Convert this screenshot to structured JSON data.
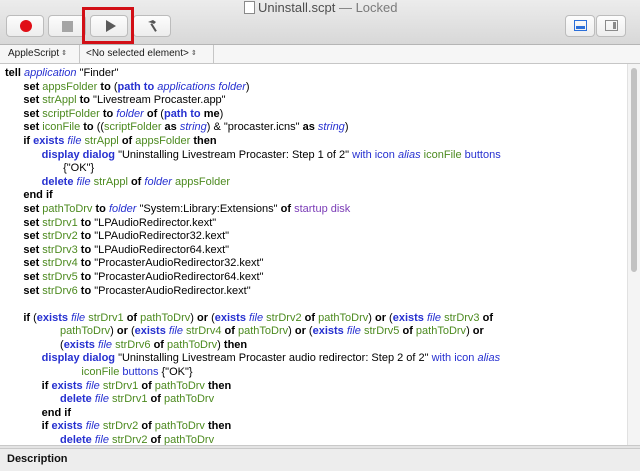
{
  "window": {
    "title": "Uninstall.scpt",
    "title_separator": "—",
    "status": "Locked"
  },
  "toolbar": {
    "record_icon": "record-icon",
    "stop_icon": "stop-icon",
    "run_icon": "play-icon",
    "compile_icon": "hammer-icon",
    "view_split_icon": "split-view-icon",
    "view_side_icon": "sidebar-view-icon",
    "accent": "#2b6fd9",
    "highlight_color": "#d20f16"
  },
  "navigation": {
    "language": "AppleScript",
    "element": "<No selected element>"
  },
  "script": {
    "lines": [
      [
        {
          "t": "tell ",
          "c": "kw"
        },
        {
          "t": "application",
          "c": "cls"
        },
        {
          "t": " \"Finder\"",
          "c": "str"
        }
      ],
      [
        {
          "t": "      set ",
          "c": "kw"
        },
        {
          "t": "appsFolder",
          "c": "var"
        },
        {
          "t": " to ",
          "c": "kw"
        },
        {
          "t": "(",
          "c": "str"
        },
        {
          "t": "path to",
          "c": "cmd"
        },
        {
          "t": " ",
          "c": "str"
        },
        {
          "t": "applications folder",
          "c": "cls"
        },
        {
          "t": ")",
          "c": "str"
        }
      ],
      [
        {
          "t": "      set ",
          "c": "kw"
        },
        {
          "t": "strAppl",
          "c": "var"
        },
        {
          "t": " to ",
          "c": "kw"
        },
        {
          "t": "\"Livestream Procaster.app\"",
          "c": "str"
        }
      ],
      [
        {
          "t": "      set ",
          "c": "kw"
        },
        {
          "t": "scriptFolder",
          "c": "var"
        },
        {
          "t": " to ",
          "c": "kw"
        },
        {
          "t": "folder",
          "c": "cls"
        },
        {
          "t": " of ",
          "c": "kw"
        },
        {
          "t": "(",
          "c": "str"
        },
        {
          "t": "path to",
          "c": "cmd"
        },
        {
          "t": " me",
          "c": "kw"
        },
        {
          "t": ")",
          "c": "str"
        }
      ],
      [
        {
          "t": "      set ",
          "c": "kw"
        },
        {
          "t": "iconFile",
          "c": "var"
        },
        {
          "t": " to ",
          "c": "kw"
        },
        {
          "t": "((",
          "c": "str"
        },
        {
          "t": "scriptFolder",
          "c": "var"
        },
        {
          "t": " as ",
          "c": "kw"
        },
        {
          "t": "string",
          "c": "cls"
        },
        {
          "t": ") & \"procaster.icns\" ",
          "c": "str"
        },
        {
          "t": "as ",
          "c": "kw"
        },
        {
          "t": "string",
          "c": "cls"
        },
        {
          "t": ")",
          "c": "str"
        }
      ],
      [
        {
          "t": "      if ",
          "c": "kw"
        },
        {
          "t": "exists",
          "c": "cmd"
        },
        {
          "t": " ",
          "c": "str"
        },
        {
          "t": "file",
          "c": "cls"
        },
        {
          "t": " ",
          "c": "str"
        },
        {
          "t": "strAppl",
          "c": "var"
        },
        {
          "t": " of ",
          "c": "kw"
        },
        {
          "t": "appsFolder",
          "c": "var"
        },
        {
          "t": " then",
          "c": "kw"
        }
      ],
      [
        {
          "t": "            display dialog",
          "c": "cmd"
        },
        {
          "t": " \"Uninstalling Livestream Procaster: Step 1 of 2\" ",
          "c": "str"
        },
        {
          "t": "with icon",
          "c": "par"
        },
        {
          "t": " ",
          "c": "str"
        },
        {
          "t": "alias",
          "c": "cls"
        },
        {
          "t": " ",
          "c": "str"
        },
        {
          "t": "iconFile",
          "c": "var"
        },
        {
          "t": " buttons",
          "c": "par"
        }
      ],
      [
        {
          "t": "                   {\"OK\"}",
          "c": "str"
        }
      ],
      [
        {
          "t": "            delete",
          "c": "cmd"
        },
        {
          "t": " ",
          "c": "str"
        },
        {
          "t": "file",
          "c": "cls"
        },
        {
          "t": " ",
          "c": "str"
        },
        {
          "t": "strAppl",
          "c": "var"
        },
        {
          "t": " of ",
          "c": "kw"
        },
        {
          "t": "folder",
          "c": "cls"
        },
        {
          "t": " ",
          "c": "str"
        },
        {
          "t": "appsFolder",
          "c": "var"
        }
      ],
      [
        {
          "t": "      end if",
          "c": "kw"
        }
      ],
      [
        {
          "t": "      set ",
          "c": "kw"
        },
        {
          "t": "pathToDrv",
          "c": "var"
        },
        {
          "t": " to ",
          "c": "kw"
        },
        {
          "t": "folder",
          "c": "cls"
        },
        {
          "t": " \"System:Library:Extensions\" ",
          "c": "str"
        },
        {
          "t": "of ",
          "c": "kw"
        },
        {
          "t": "startup disk",
          "c": "prop"
        }
      ],
      [
        {
          "t": "      set ",
          "c": "kw"
        },
        {
          "t": "strDrv1",
          "c": "var"
        },
        {
          "t": " to ",
          "c": "kw"
        },
        {
          "t": "\"LPAudioRedirector.kext\"",
          "c": "str"
        }
      ],
      [
        {
          "t": "      set ",
          "c": "kw"
        },
        {
          "t": "strDrv2",
          "c": "var"
        },
        {
          "t": " to ",
          "c": "kw"
        },
        {
          "t": "\"LPAudioRedirector32.kext\"",
          "c": "str"
        }
      ],
      [
        {
          "t": "      set ",
          "c": "kw"
        },
        {
          "t": "strDrv3",
          "c": "var"
        },
        {
          "t": " to ",
          "c": "kw"
        },
        {
          "t": "\"LPAudioRedirector64.kext\"",
          "c": "str"
        }
      ],
      [
        {
          "t": "      set ",
          "c": "kw"
        },
        {
          "t": "strDrv4",
          "c": "var"
        },
        {
          "t": " to ",
          "c": "kw"
        },
        {
          "t": "\"ProcasterAudioRedirector32.kext\"",
          "c": "str"
        }
      ],
      [
        {
          "t": "      set ",
          "c": "kw"
        },
        {
          "t": "strDrv5",
          "c": "var"
        },
        {
          "t": " to ",
          "c": "kw"
        },
        {
          "t": "\"ProcasterAudioRedirector64.kext\"",
          "c": "str"
        }
      ],
      [
        {
          "t": "      set ",
          "c": "kw"
        },
        {
          "t": "strDrv6",
          "c": "var"
        },
        {
          "t": " to ",
          "c": "kw"
        },
        {
          "t": "\"ProcasterAudioRedirector.kext\"",
          "c": "str"
        }
      ],
      [
        {
          "t": "",
          "c": "str"
        }
      ],
      [
        {
          "t": "      if ",
          "c": "kw"
        },
        {
          "t": "(",
          "c": "str"
        },
        {
          "t": "exists",
          "c": "cmd"
        },
        {
          "t": " ",
          "c": "str"
        },
        {
          "t": "file",
          "c": "cls"
        },
        {
          "t": " ",
          "c": "str"
        },
        {
          "t": "strDrv1",
          "c": "var"
        },
        {
          "t": " of ",
          "c": "kw"
        },
        {
          "t": "pathToDrv",
          "c": "var"
        },
        {
          "t": ") ",
          "c": "str"
        },
        {
          "t": "or",
          "c": "kw"
        },
        {
          "t": " (",
          "c": "str"
        },
        {
          "t": "exists",
          "c": "cmd"
        },
        {
          "t": " ",
          "c": "str"
        },
        {
          "t": "file",
          "c": "cls"
        },
        {
          "t": " ",
          "c": "str"
        },
        {
          "t": "strDrv2",
          "c": "var"
        },
        {
          "t": " of ",
          "c": "kw"
        },
        {
          "t": "pathToDrv",
          "c": "var"
        },
        {
          "t": ") ",
          "c": "str"
        },
        {
          "t": "or",
          "c": "kw"
        },
        {
          "t": " (",
          "c": "str"
        },
        {
          "t": "exists",
          "c": "cmd"
        },
        {
          "t": " ",
          "c": "str"
        },
        {
          "t": "file",
          "c": "cls"
        },
        {
          "t": " ",
          "c": "str"
        },
        {
          "t": "strDrv3",
          "c": "var"
        },
        {
          "t": " of",
          "c": "kw"
        }
      ],
      [
        {
          "t": "                  ",
          "c": "str"
        },
        {
          "t": "pathToDrv",
          "c": "var"
        },
        {
          "t": ") ",
          "c": "str"
        },
        {
          "t": "or",
          "c": "kw"
        },
        {
          "t": " (",
          "c": "str"
        },
        {
          "t": "exists",
          "c": "cmd"
        },
        {
          "t": " ",
          "c": "str"
        },
        {
          "t": "file",
          "c": "cls"
        },
        {
          "t": " ",
          "c": "str"
        },
        {
          "t": "strDrv4",
          "c": "var"
        },
        {
          "t": " of ",
          "c": "kw"
        },
        {
          "t": "pathToDrv",
          "c": "var"
        },
        {
          "t": ") ",
          "c": "str"
        },
        {
          "t": "or",
          "c": "kw"
        },
        {
          "t": " (",
          "c": "str"
        },
        {
          "t": "exists",
          "c": "cmd"
        },
        {
          "t": " ",
          "c": "str"
        },
        {
          "t": "file",
          "c": "cls"
        },
        {
          "t": " ",
          "c": "str"
        },
        {
          "t": "strDrv5",
          "c": "var"
        },
        {
          "t": " of ",
          "c": "kw"
        },
        {
          "t": "pathToDrv",
          "c": "var"
        },
        {
          "t": ") ",
          "c": "str"
        },
        {
          "t": "or",
          "c": "kw"
        }
      ],
      [
        {
          "t": "                  (",
          "c": "str"
        },
        {
          "t": "exists",
          "c": "cmd"
        },
        {
          "t": " ",
          "c": "str"
        },
        {
          "t": "file",
          "c": "cls"
        },
        {
          "t": " ",
          "c": "str"
        },
        {
          "t": "strDrv6",
          "c": "var"
        },
        {
          "t": " of ",
          "c": "kw"
        },
        {
          "t": "pathToDrv",
          "c": "var"
        },
        {
          "t": ") ",
          "c": "str"
        },
        {
          "t": "then",
          "c": "kw"
        }
      ],
      [
        {
          "t": "            display dialog",
          "c": "cmd"
        },
        {
          "t": " \"Uninstalling Livestream Procaster audio redirector: Step 2 of 2\" ",
          "c": "str"
        },
        {
          "t": "with icon",
          "c": "par"
        },
        {
          "t": " ",
          "c": "str"
        },
        {
          "t": "alias",
          "c": "cls"
        }
      ],
      [
        {
          "t": "                         ",
          "c": "str"
        },
        {
          "t": "iconFile",
          "c": "var"
        },
        {
          "t": " buttons",
          "c": "par"
        },
        {
          "t": " {\"OK\"}",
          "c": "str"
        }
      ],
      [
        {
          "t": "            if ",
          "c": "kw"
        },
        {
          "t": "exists",
          "c": "cmd"
        },
        {
          "t": " ",
          "c": "str"
        },
        {
          "t": "file",
          "c": "cls"
        },
        {
          "t": " ",
          "c": "str"
        },
        {
          "t": "strDrv1",
          "c": "var"
        },
        {
          "t": " of ",
          "c": "kw"
        },
        {
          "t": "pathToDrv",
          "c": "var"
        },
        {
          "t": " then",
          "c": "kw"
        }
      ],
      [
        {
          "t": "                  delete",
          "c": "cmd"
        },
        {
          "t": " ",
          "c": "str"
        },
        {
          "t": "file",
          "c": "cls"
        },
        {
          "t": " ",
          "c": "str"
        },
        {
          "t": "strDrv1",
          "c": "var"
        },
        {
          "t": " of ",
          "c": "kw"
        },
        {
          "t": "pathToDrv",
          "c": "var"
        }
      ],
      [
        {
          "t": "            end if",
          "c": "kw"
        }
      ],
      [
        {
          "t": "            if ",
          "c": "kw"
        },
        {
          "t": "exists",
          "c": "cmd"
        },
        {
          "t": " ",
          "c": "str"
        },
        {
          "t": "file",
          "c": "cls"
        },
        {
          "t": " ",
          "c": "str"
        },
        {
          "t": "strDrv2",
          "c": "var"
        },
        {
          "t": " of ",
          "c": "kw"
        },
        {
          "t": "pathToDrv",
          "c": "var"
        },
        {
          "t": " then",
          "c": "kw"
        }
      ],
      [
        {
          "t": "                  delete",
          "c": "cmd"
        },
        {
          "t": " ",
          "c": "str"
        },
        {
          "t": "file",
          "c": "cls"
        },
        {
          "t": " ",
          "c": "str"
        },
        {
          "t": "strDrv2",
          "c": "var"
        },
        {
          "t": " of ",
          "c": "kw"
        },
        {
          "t": "pathToDrv",
          "c": "var"
        }
      ]
    ]
  },
  "bottom": {
    "description_tab": "Description"
  }
}
